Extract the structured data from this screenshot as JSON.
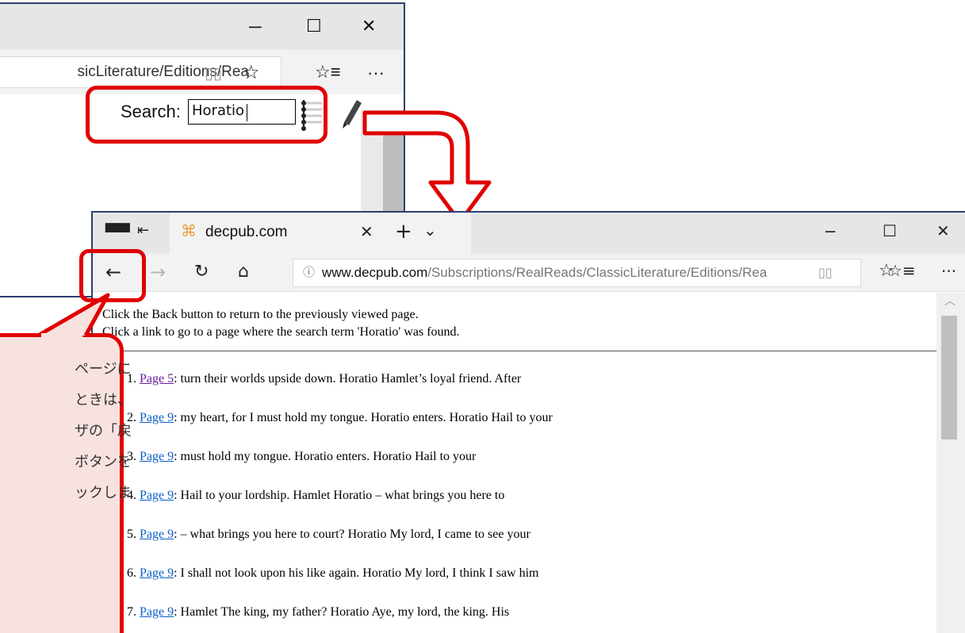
{
  "back_window": {
    "address_fragment": "sicLiterature/Editions/Rea",
    "search_label": "Search:",
    "search_value": "Horatio"
  },
  "front_window": {
    "tab_title": "decpub.com",
    "address_host": "www.decpub.com",
    "address_path": "/Subscriptions/RealReads/ClassicLiterature/Editions/Rea",
    "intro_lines": [
      "Click the Back button to return to the previously viewed page.",
      "Click a link to go to a page where the search term 'Horatio' was found."
    ],
    "results": [
      {
        "num": "1.",
        "link": "Page 5",
        "text": ": turn their worlds upside down. Horatio Hamlet’s loyal friend. After",
        "visited": true
      },
      {
        "num": "2.",
        "link": "Page 9",
        "text": ": my heart, for I must hold my tongue. Horatio enters. Horatio Hail to your",
        "visited": false
      },
      {
        "num": "3.",
        "link": "Page 9",
        "text": ": must hold my tongue. Horatio enters. Horatio Hail to your",
        "visited": false
      },
      {
        "num": "4.",
        "link": "Page 9",
        "text": ": Hail to your lordship. Hamlet Horatio – what brings you here to",
        "visited": false
      },
      {
        "num": "5.",
        "link": "Page 9",
        "text": ": – what brings you here to court? Horatio My lord, I came to see your",
        "visited": false
      },
      {
        "num": "6.",
        "link": "Page 9",
        "text": ": I shall not look upon his like again. Horatio My lord, I think I saw him",
        "visited": false
      },
      {
        "num": "7.",
        "link": "Page 9",
        "text": ": Hamlet The king, my father? Horatio Aye, my lord, the king. His",
        "visited": false
      }
    ]
  },
  "note_lines": [
    "ページに",
    "ときは、",
    "ザの「戻",
    "ボタンを",
    "ックしま"
  ],
  "colors": {
    "annotation_red": "#e00000",
    "note_fill": "#f7e2e0",
    "link": "#0b5fc8",
    "visited_link": "#6a1b9a"
  }
}
